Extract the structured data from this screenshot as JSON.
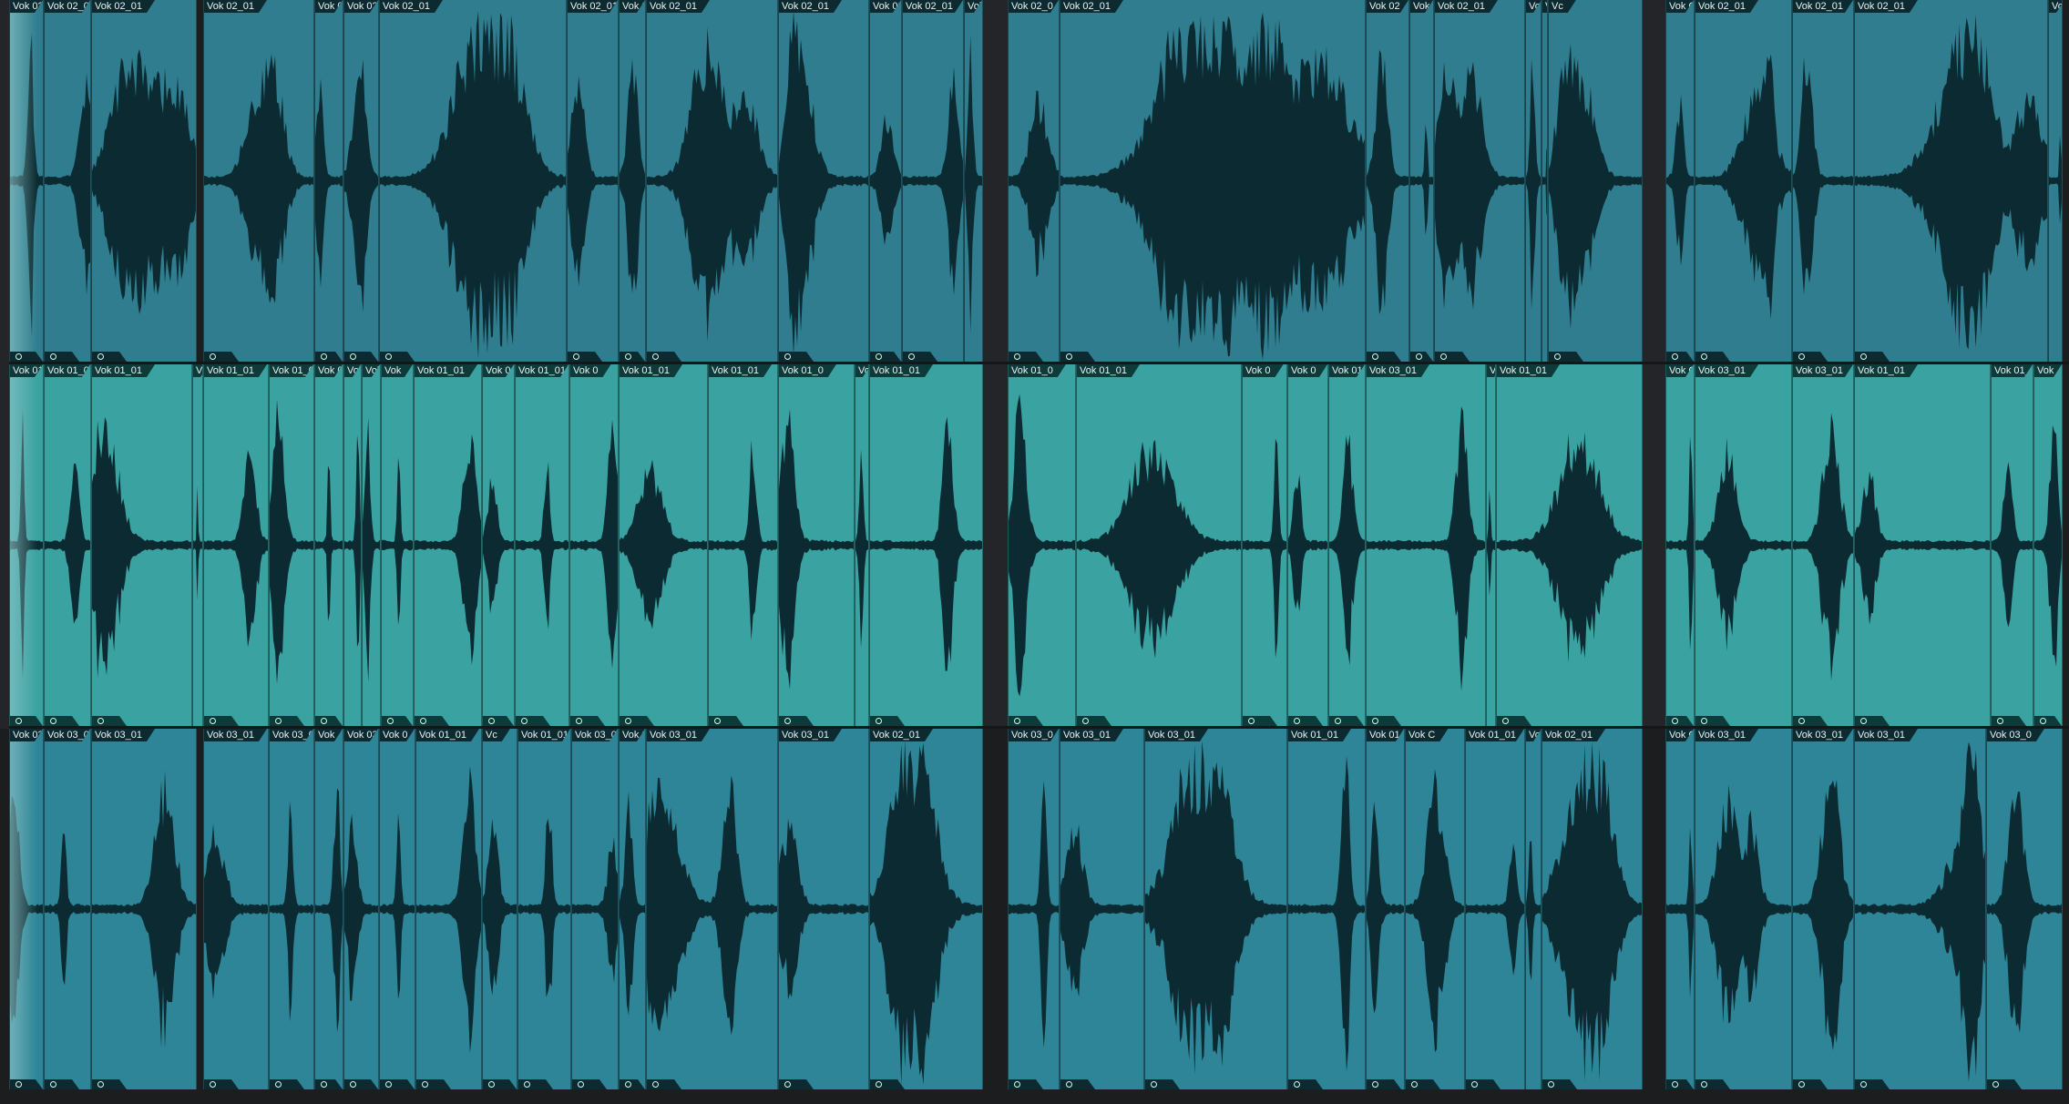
{
  "colors": {
    "background": "#1c1d1f",
    "waveform": "#0b2a31",
    "lane_top": "#2f7d8e",
    "lane_mid": "#3aa2a1",
    "lane_bottom": "#2e8597",
    "fade_overlay": "#8fc6c9"
  },
  "lanes": [
    {
      "id": "top",
      "color": "#2f7d8e",
      "regions": [
        {
          "label": "Vok 02",
          "start": 0.005,
          "end": 0.021
        },
        {
          "label": "Vok 02_0",
          "start": 0.021,
          "end": 0.044
        },
        {
          "label": "Vok 02_01",
          "start": 0.044,
          "end": 0.095
        },
        {
          "label": "Vok 02_01",
          "start": 0.098,
          "end": 0.152
        },
        {
          "label": "Vok 0",
          "start": 0.152,
          "end": 0.166
        },
        {
          "label": "Vok 02",
          "start": 0.166,
          "end": 0.183
        },
        {
          "label": "Vok 02_01",
          "start": 0.183,
          "end": 0.274
        },
        {
          "label": "Vok 02_01",
          "start": 0.274,
          "end": 0.299
        },
        {
          "label": "Vok 02",
          "start": 0.299,
          "end": 0.312
        },
        {
          "label": "Vok 02_01",
          "start": 0.312,
          "end": 0.376
        },
        {
          "label": "Vok 02_01",
          "start": 0.376,
          "end": 0.42
        },
        {
          "label": "Vok 02",
          "start": 0.42,
          "end": 0.436
        },
        {
          "label": "Vok 02_01",
          "start": 0.436,
          "end": 0.466
        },
        {
          "label": "Vok",
          "start": 0.466,
          "end": 0.475
        },
        {
          "label": "Vok 02_0",
          "start": 0.487,
          "end": 0.512
        },
        {
          "label": "Vok 02_01",
          "start": 0.512,
          "end": 0.66
        },
        {
          "label": "Vok 02",
          "start": 0.66,
          "end": 0.681
        },
        {
          "label": "Vok 02",
          "start": 0.681,
          "end": 0.693
        },
        {
          "label": "Vok 02_01",
          "start": 0.693,
          "end": 0.737
        },
        {
          "label": "Vok",
          "start": 0.737,
          "end": 0.745
        },
        {
          "label": "Vo",
          "start": 0.745,
          "end": 0.748
        },
        {
          "label": "Vc",
          "start": 0.748,
          "end": 0.794
        },
        {
          "label": "Vok C",
          "start": 0.805,
          "end": 0.819
        },
        {
          "label": "Vok 02_01",
          "start": 0.819,
          "end": 0.866
        },
        {
          "label": "Vok 02_01",
          "start": 0.866,
          "end": 0.896
        },
        {
          "label": "Vok 02_01",
          "start": 0.896,
          "end": 0.99
        },
        {
          "label": "Vok",
          "start": 0.99,
          "end": 0.997
        }
      ]
    },
    {
      "id": "mid",
      "color": "#3aa2a1",
      "regions": [
        {
          "label": "Vok 01",
          "start": 0.005,
          "end": 0.021
        },
        {
          "label": "Vok 01_0",
          "start": 0.021,
          "end": 0.044
        },
        {
          "label": "Vok 01_01",
          "start": 0.044,
          "end": 0.093
        },
        {
          "label": "Vo",
          "start": 0.093,
          "end": 0.098
        },
        {
          "label": "Vok 01_01",
          "start": 0.098,
          "end": 0.13
        },
        {
          "label": "Vok 01_0",
          "start": 0.13,
          "end": 0.152
        },
        {
          "label": "Vok 0",
          "start": 0.152,
          "end": 0.166
        },
        {
          "label": "Vok",
          "start": 0.166,
          "end": 0.175
        },
        {
          "label": "Vok",
          "start": 0.175,
          "end": 0.184
        },
        {
          "label": "Vok",
          "start": 0.184,
          "end": 0.2
        },
        {
          "label": "Vok 01_01",
          "start": 0.2,
          "end": 0.233
        },
        {
          "label": "Vok 01",
          "start": 0.233,
          "end": 0.249
        },
        {
          "label": "Vok 01_01",
          "start": 0.249,
          "end": 0.275
        },
        {
          "label": "Vok 0",
          "start": 0.275,
          "end": 0.299
        },
        {
          "label": "Vok 01_01",
          "start": 0.299,
          "end": 0.342
        },
        {
          "label": "Vok 01_01",
          "start": 0.342,
          "end": 0.376
        },
        {
          "label": "Vok 01_0",
          "start": 0.376,
          "end": 0.413
        },
        {
          "label": "Vok",
          "start": 0.413,
          "end": 0.42
        },
        {
          "label": "Vok 01_01",
          "start": 0.42,
          "end": 0.475
        },
        {
          "label": "Vok 01_0",
          "start": 0.487,
          "end": 0.52
        },
        {
          "label": "Vok 01_01",
          "start": 0.52,
          "end": 0.6
        },
        {
          "label": "Vok 0",
          "start": 0.6,
          "end": 0.622
        },
        {
          "label": "Vok 0",
          "start": 0.622,
          "end": 0.642
        },
        {
          "label": "Vok 01",
          "start": 0.642,
          "end": 0.66
        },
        {
          "label": "Vok 03_01",
          "start": 0.66,
          "end": 0.718
        },
        {
          "label": "V",
          "start": 0.718,
          "end": 0.723
        },
        {
          "label": "Vok 01_01",
          "start": 0.723,
          "end": 0.794
        },
        {
          "label": "Vok C",
          "start": 0.805,
          "end": 0.819
        },
        {
          "label": "Vok 03_01",
          "start": 0.819,
          "end": 0.866
        },
        {
          "label": "Vok 03_01",
          "start": 0.866,
          "end": 0.896
        },
        {
          "label": "Vok 01_01",
          "start": 0.896,
          "end": 0.962
        },
        {
          "label": "Vok 01_",
          "start": 0.962,
          "end": 0.983
        },
        {
          "label": "Vok",
          "start": 0.983,
          "end": 0.997
        }
      ]
    },
    {
      "id": "bottom",
      "color": "#2e8597",
      "regions": [
        {
          "label": "Vok 03",
          "start": 0.005,
          "end": 0.021
        },
        {
          "label": "Vok 03_0",
          "start": 0.021,
          "end": 0.044
        },
        {
          "label": "Vok 03_01",
          "start": 0.044,
          "end": 0.095
        },
        {
          "label": "Vok 03_01",
          "start": 0.098,
          "end": 0.13
        },
        {
          "label": "Vok 03_0",
          "start": 0.13,
          "end": 0.152
        },
        {
          "label": "Vok",
          "start": 0.152,
          "end": 0.166
        },
        {
          "label": "Vok 03",
          "start": 0.166,
          "end": 0.183
        },
        {
          "label": "Vok 0",
          "start": 0.183,
          "end": 0.201
        },
        {
          "label": "Vok 01_01",
          "start": 0.201,
          "end": 0.233
        },
        {
          "label": "Vc",
          "start": 0.233,
          "end": 0.25
        },
        {
          "label": "Vok 01_01",
          "start": 0.25,
          "end": 0.276
        },
        {
          "label": "Vok 03_01",
          "start": 0.276,
          "end": 0.299
        },
        {
          "label": "Vok 0",
          "start": 0.299,
          "end": 0.312
        },
        {
          "label": "Vok 03_01",
          "start": 0.312,
          "end": 0.376
        },
        {
          "label": "Vok 03_01",
          "start": 0.376,
          "end": 0.42
        },
        {
          "label": "Vok 02_01",
          "start": 0.42,
          "end": 0.475
        },
        {
          "label": "Vok 03_0",
          "start": 0.487,
          "end": 0.512
        },
        {
          "label": "Vok 03_01",
          "start": 0.512,
          "end": 0.553
        },
        {
          "label": "Vok 03_01",
          "start": 0.553,
          "end": 0.622
        },
        {
          "label": "Vok 01_01",
          "start": 0.622,
          "end": 0.66
        },
        {
          "label": "Vok 01",
          "start": 0.66,
          "end": 0.679
        },
        {
          "label": "Vok C",
          "start": 0.679,
          "end": 0.708
        },
        {
          "label": "Vok 01_01",
          "start": 0.708,
          "end": 0.737
        },
        {
          "label": "Vok",
          "start": 0.737,
          "end": 0.745
        },
        {
          "label": "Vok 02_01",
          "start": 0.745,
          "end": 0.794
        },
        {
          "label": "Vok C",
          "start": 0.805,
          "end": 0.819
        },
        {
          "label": "Vok 03_01",
          "start": 0.819,
          "end": 0.866
        },
        {
          "label": "Vok 03_01",
          "start": 0.866,
          "end": 0.896
        },
        {
          "label": "Vok 03_01",
          "start": 0.896,
          "end": 0.96
        },
        {
          "label": "Vok 03_0",
          "start": 0.96,
          "end": 0.997
        }
      ]
    }
  ]
}
